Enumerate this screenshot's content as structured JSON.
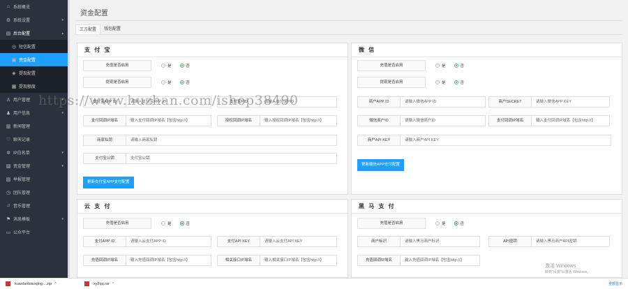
{
  "sidebar": {
    "items": [
      {
        "icon": "home-icon",
        "glyph": "⌂",
        "label": "系統概览",
        "arrow": ""
      },
      {
        "icon": "gear-icon",
        "glyph": "⚙",
        "label": "系統设置",
        "arrow": "▾"
      },
      {
        "icon": "list-icon",
        "glyph": "▤",
        "label": "后台配置",
        "arrow": "▴",
        "open": true
      },
      {
        "icon": "info-icon",
        "glyph": "◎",
        "label": "短信配置",
        "sub": true
      },
      {
        "icon": "card-icon",
        "glyph": "▣",
        "label": "资金配置",
        "sub": true,
        "active": true
      },
      {
        "icon": "tag-icon",
        "glyph": "◈",
        "label": "提现配置",
        "sub": true
      },
      {
        "icon": "grid-icon",
        "glyph": "▦",
        "label": "提现额度",
        "sub": true
      },
      {
        "icon": "user-icon",
        "glyph": "♙",
        "label": "用户管理",
        "arrow": "▾"
      },
      {
        "icon": "users-icon",
        "glyph": "♟",
        "label": "用户信息",
        "arrow": "▾"
      },
      {
        "icon": "book-icon",
        "glyph": "▥",
        "label": "新闻管理",
        "arrow": ""
      },
      {
        "icon": "heart-icon",
        "glyph": "♡",
        "label": "聊天记录",
        "arrow": ""
      },
      {
        "icon": "wheel-icon",
        "glyph": "✲",
        "label": "IP白名单",
        "arrow": "▾"
      },
      {
        "icon": "wallet-icon",
        "glyph": "▧",
        "label": "资金管理",
        "arrow": "▾"
      },
      {
        "icon": "doc-icon",
        "glyph": "▨",
        "label": "举报管理",
        "arrow": ""
      },
      {
        "icon": "clock-icon",
        "glyph": "◷",
        "label": "团队管理",
        "arrow": ""
      },
      {
        "icon": "music-icon",
        "glyph": "♫",
        "label": "音乐管理",
        "arrow": ""
      },
      {
        "icon": "flag-icon",
        "glyph": "⚑",
        "label": "消息模板",
        "arrow": "▾"
      },
      {
        "icon": "screen-icon",
        "glyph": "▭",
        "label": "公众平台",
        "arrow": ""
      }
    ]
  },
  "header": {
    "title": "资金配置"
  },
  "tabs": [
    {
      "label": "三方配置",
      "active": true
    },
    {
      "label": "钱包配置",
      "active": false
    }
  ],
  "radio": {
    "yes": "是",
    "no": "否"
  },
  "alipay": {
    "title": "支 付 宝",
    "rows": [
      {
        "label": "充值是否启用",
        "selected": "no",
        "yes_variant": "是"
      },
      {
        "label": "提现是否启用",
        "selected": "no",
        "yes_variant": "是"
      }
    ],
    "fields": {
      "app_id": {
        "label": "支付宝APP ID",
        "placeholder": "请输入支付宝APP ID"
      },
      "pid": {
        "label": "支付宝PID",
        "placeholder": "请输入支付宝PID"
      },
      "notify": {
        "label": "支付回调IP域名",
        "placeholder": "输入支付回调IP域名【包含http://】"
      },
      "return": {
        "label": "授权回调IP域名",
        "placeholder": "输入授权回调IP域名【包含http://】"
      },
      "merchant": {
        "label": "商家私钥",
        "placeholder": "请输入商家私钥"
      },
      "public": {
        "label": "支付宝公钥",
        "placeholder": "支付宝公钥"
      }
    },
    "button": "更新支付宝APP支付配置"
  },
  "wechat": {
    "title": "微 信",
    "rows": [
      {
        "label": "充值是否启用",
        "selected": "no",
        "yes_variant": "是"
      },
      {
        "label": "提现是否启用",
        "selected": "no",
        "yes_variant": "是"
      }
    ],
    "fields": {
      "app_id": {
        "label": "商户APP ID",
        "placeholder": "请输入微信APP ID"
      },
      "secret": {
        "label": "商户SECRET",
        "placeholder": "请输入微信APP KEY"
      },
      "mch_id": {
        "label": "微信商户ID",
        "placeholder": "请输入微信商户ID"
      },
      "notify": {
        "label": "支付回调IP域名",
        "placeholder": "输入支付回调IP域名【包含http://】"
      },
      "api_key": {
        "label": "商户API KEY",
        "placeholder": "请输入商户API KEY"
      }
    },
    "button": "更新微信APP支付配置"
  },
  "yunpay": {
    "title": "云 支 付",
    "rows": [
      {
        "label": "充值是否启用",
        "selected": "no",
        "yes_variant": "是"
      }
    ],
    "fields": {
      "app_id": {
        "label": "支付APP ID",
        "placeholder": "请输入云支付APP ID"
      },
      "api_key": {
        "label": "支付API KEY",
        "placeholder": "请输入云支付API KEY"
      },
      "notify": {
        "label": "充值回调IP域名",
        "placeholder": "输入充值回调IP域名【包含http://】"
      },
      "related": {
        "label": "相关接口IP域名",
        "placeholder": "输入相关接口IP域名【包含http://】"
      }
    }
  },
  "heima": {
    "title": "黑 马 支 付",
    "rows": [
      {
        "label": "充值是否启用",
        "selected": "no",
        "yes_variant": "是"
      }
    ],
    "fields": {
      "merchant": {
        "label": "商户标识",
        "placeholder": "请输入黑马商户标识"
      },
      "api_key": {
        "label": "API密钥",
        "placeholder": "请输入黑马商户API密钥"
      },
      "notify": {
        "label": "充值回调IP域名",
        "placeholder": "输入充值回调IP域名【包含http://】"
      }
    }
  },
  "watermark": "https://www.huzhan.com/ishop38490",
  "windows": {
    "line1": "激活 Windows",
    "line2": "转到\"设置\"以激活 Windows。"
  },
  "downloads": {
    "items": [
      {
        "name": "kuanlanbiaoqing....zip"
      },
      {
        "name": "xy2qq.rar"
      }
    ],
    "show_all": "全部显示"
  }
}
